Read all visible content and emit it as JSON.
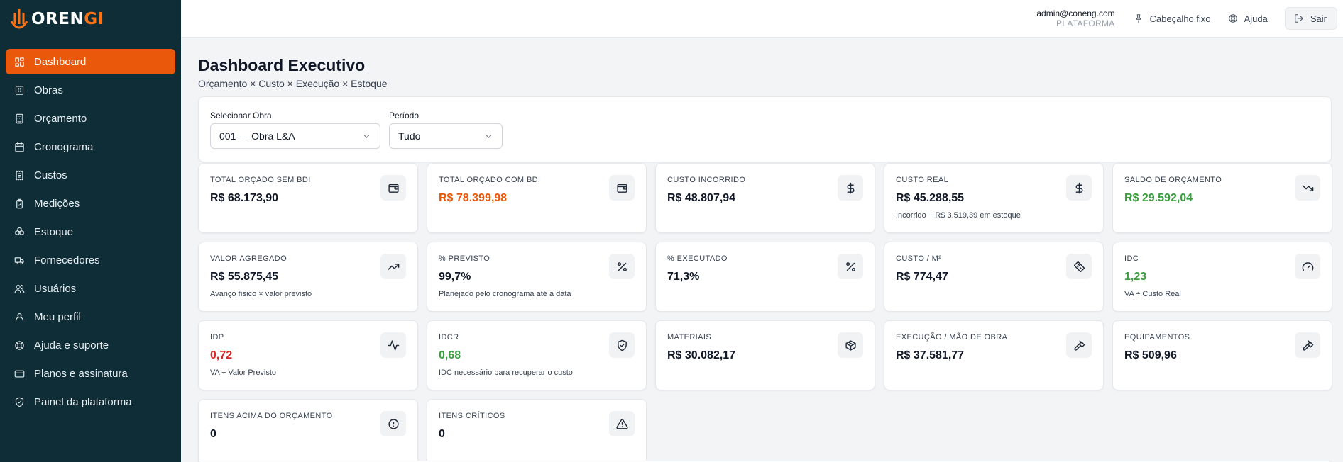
{
  "brand": {
    "logo_prefix": "OREN",
    "logo_suffix": "GI",
    "accent_color": "#ea580c"
  },
  "sidebar": {
    "items": [
      {
        "label": "Dashboard",
        "icon": "layout-grid-icon",
        "active": true
      },
      {
        "label": "Obras",
        "icon": "building-icon"
      },
      {
        "label": "Orçamento",
        "icon": "calculator-icon"
      },
      {
        "label": "Cronograma",
        "icon": "calendar-icon"
      },
      {
        "label": "Custos",
        "icon": "receipt-icon"
      },
      {
        "label": "Medições",
        "icon": "clipboard-check-icon"
      },
      {
        "label": "Estoque",
        "icon": "boxes-icon"
      },
      {
        "label": "Fornecedores",
        "icon": "truck-icon"
      },
      {
        "label": "Usuários",
        "icon": "users-icon"
      },
      {
        "label": "Meu perfil",
        "icon": "user-icon"
      },
      {
        "label": "Ajuda e suporte",
        "icon": "lifebuoy-icon"
      },
      {
        "label": "Planos e assinatura",
        "icon": "credit-card-icon"
      },
      {
        "label": "Painel da plataforma",
        "icon": "shield-check-icon"
      }
    ]
  },
  "header": {
    "email": "admin@coneng.com",
    "role": "PLATAFORMA",
    "pin_label": "Cabeçalho fixo",
    "help_label": "Ajuda",
    "logout_label": "Sair"
  },
  "page": {
    "title": "Dashboard Executivo",
    "subtitle": "Orçamento × Custo × Execução × Estoque"
  },
  "filters": {
    "obra_label": "Selecionar Obra",
    "obra_value": "001 — Obra L&A",
    "periodo_label": "Período",
    "periodo_value": "Tudo"
  },
  "cards": [
    {
      "label": "TOTAL ORÇADO SEM BDI",
      "value": "R$ 68.173,90",
      "color": "default",
      "note": "",
      "icon": "wallet-icon"
    },
    {
      "label": "TOTAL ORÇADO COM BDI",
      "value": "R$ 78.399,98",
      "color": "orange",
      "note": "",
      "icon": "wallet-icon"
    },
    {
      "label": "CUSTO INCORRIDO",
      "value": "R$ 48.807,94",
      "color": "default",
      "note": "",
      "icon": "dollar-icon"
    },
    {
      "label": "CUSTO REAL",
      "value": "R$ 45.288,55",
      "color": "default",
      "note": "Incorrido − R$ 3.519,39 em estoque",
      "icon": "dollar-icon"
    },
    {
      "label": "SALDO DE ORÇAMENTO",
      "value": "R$ 29.592,04",
      "color": "green",
      "note": "",
      "icon": "trending-down-icon"
    },
    {
      "label": "VALOR AGREGADO",
      "value": "R$ 55.875,45",
      "color": "default",
      "note": "Avanço físico × valor previsto",
      "icon": "trending-up-icon"
    },
    {
      "label": "% PREVISTO",
      "value": "99,7%",
      "color": "default",
      "note": "Planejado pelo cronograma até a data",
      "icon": "percent-icon"
    },
    {
      "label": "% EXECUTADO",
      "value": "71,3%",
      "color": "default",
      "note": "",
      "icon": "percent-icon"
    },
    {
      "label": "CUSTO / M²",
      "value": "R$ 774,47",
      "color": "default",
      "note": "",
      "icon": "ruler-icon"
    },
    {
      "label": "IDC",
      "value": "1,23",
      "color": "green",
      "note": "VA ÷ Custo Real",
      "icon": "gauge-icon"
    },
    {
      "label": "IDP",
      "value": "0,72",
      "color": "red",
      "note": "VA ÷ Valor Previsto",
      "icon": "activity-icon"
    },
    {
      "label": "IDCR",
      "value": "0,68",
      "color": "green",
      "note": "IDC necessário para recuperar o custo",
      "icon": "shield-check-icon"
    },
    {
      "label": "MATERIAIS",
      "value": "R$ 30.082,17",
      "color": "default",
      "note": "",
      "icon": "package-icon"
    },
    {
      "label": "EXECUÇÃO / MÃO DE OBRA",
      "value": "R$ 37.581,77",
      "color": "default",
      "note": "",
      "icon": "hammer-icon"
    },
    {
      "label": "EQUIPAMENTOS",
      "value": "R$ 509,96",
      "color": "default",
      "note": "",
      "icon": "hammer-icon"
    },
    {
      "label": "ITENS ACIMA DO ORÇAMENTO",
      "value": "0",
      "color": "default",
      "note": "",
      "icon": "alert-circle-icon"
    },
    {
      "label": "ITENS CRÍTICOS",
      "value": "0",
      "color": "default",
      "note": "",
      "icon": "alert-triangle-icon"
    }
  ]
}
